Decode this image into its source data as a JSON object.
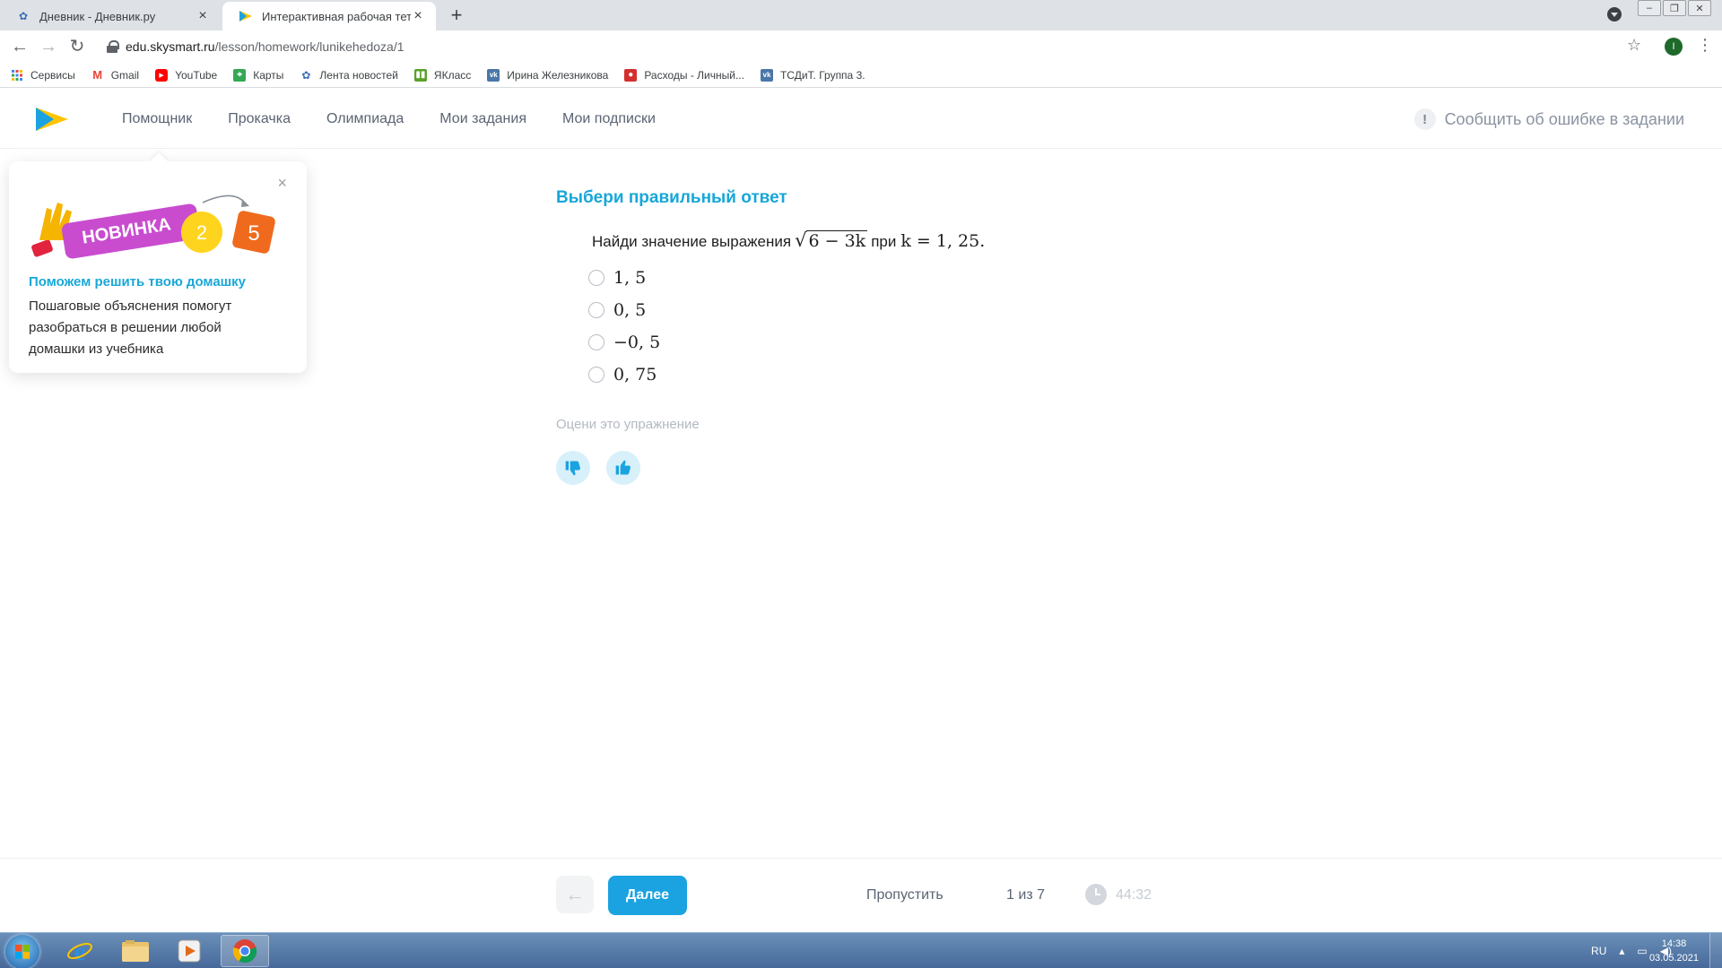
{
  "browser": {
    "tabs": [
      {
        "title": "Дневник - Дневник.ру",
        "active": false
      },
      {
        "title": "Интерактивная рабочая тетрадь",
        "active": true
      }
    ],
    "new_tab": "+",
    "url_host": "edu.skysmart.ru",
    "url_path": "/lesson/homework/lunikehedoza/1",
    "profile_initial": "I",
    "bookmarks": [
      {
        "label": "Сервисы",
        "icon": "apps-grid-icon",
        "color": "#4285f4"
      },
      {
        "label": "Gmail",
        "icon": "gmail-icon",
        "color": "#ea4335"
      },
      {
        "label": "YouTube",
        "icon": "youtube-icon",
        "color": "#ff0000"
      },
      {
        "label": "Карты",
        "icon": "maps-icon",
        "color": "#34a853"
      },
      {
        "label": "Лента новостей",
        "icon": "dnevnik-icon",
        "color": "#3b6fb6"
      },
      {
        "label": "ЯКласс",
        "icon": "yaklass-icon",
        "color": "#5aa02c"
      },
      {
        "label": "Ирина Железникова",
        "icon": "vk-icon",
        "color": "#4a76a8"
      },
      {
        "label": "Расходы - Личный...",
        "icon": "expenses-icon",
        "color": "#d32f2f"
      },
      {
        "label": "ТСДиТ. Группа 3.",
        "icon": "vk-icon",
        "color": "#4a76a8"
      }
    ]
  },
  "site": {
    "nav": [
      "Помощник",
      "Прокачка",
      "Олимпиада",
      "Мои задания",
      "Мои подписки"
    ],
    "report_error": "Сообщить об ошибке в задании",
    "report_icon": "!"
  },
  "promo": {
    "badge": "НОВИНКА",
    "grade_from": "2",
    "grade_to": "5",
    "close": "×",
    "heading": "Поможем решить твою домашку",
    "text": "Пошаговые объяснения помогут разобраться в решении любой домашки из учебника"
  },
  "exercise": {
    "title": "Выбери правильный ответ",
    "question_prefix": "Найди значение выражения",
    "radicand": "6 − 3k",
    "question_mid": "при",
    "condition": "k = 1, 25.",
    "options": [
      "1, 5",
      "0, 5",
      "−0, 5",
      "0, 75"
    ],
    "rate_label": "Оцени это упражнение"
  },
  "footer": {
    "back": "←",
    "next": "Далее",
    "skip": "Пропустить",
    "progress": "1 из 7",
    "timer": "44:32"
  },
  "taskbar": {
    "lang": "RU",
    "time": "14:38",
    "date": "03.05.2021"
  },
  "colors": {
    "accent": "#1aa3e0",
    "title": "#17a7d8"
  }
}
